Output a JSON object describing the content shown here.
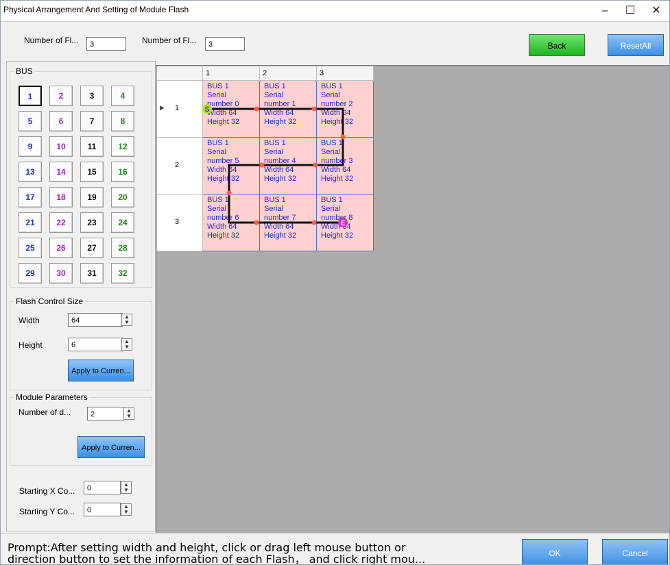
{
  "window": {
    "title": "Physical Arrangement And Setting of Module Flash",
    "minimize_glyph": "–",
    "maximize_glyph": "☐",
    "close_glyph": "✕"
  },
  "topbar": {
    "rows_label": "Number of Fl...",
    "rows_value": "3",
    "cols_label": "Number of Fl...",
    "cols_value": "3",
    "back_label": "Back",
    "reset_label": "ResetAll"
  },
  "bus": {
    "title": "BUS",
    "buttons": [
      "1",
      "2",
      "3",
      "4",
      "5",
      "6",
      "7",
      "8",
      "9",
      "10",
      "11",
      "12",
      "13",
      "14",
      "15",
      "16",
      "17",
      "18",
      "19",
      "20",
      "21",
      "22",
      "23",
      "24",
      "25",
      "26",
      "27",
      "28",
      "29",
      "30",
      "31",
      "32"
    ]
  },
  "flash_size": {
    "title": "Flash Control Size",
    "width_label": "Width",
    "width_value": "64",
    "height_label": "Height",
    "height_value": "6",
    "apply_label": "Apply to Curren..."
  },
  "module_params": {
    "title": "Module Parameters",
    "num_label": "Number of d...",
    "num_value": "2",
    "apply_label": "Apply to Curren..."
  },
  "start": {
    "x_label": "Starting X Co...",
    "x_value": "0",
    "y_label": "Starting Y Co...",
    "y_value": "0"
  },
  "grid": {
    "col_headers": [
      "1",
      "2",
      "3"
    ],
    "row_headers": [
      "1",
      "2",
      "3"
    ],
    "current_row_marker": "▶",
    "start_marker": "S",
    "end_marker": "E",
    "cells": [
      [
        {
          "bus": "BUS 1",
          "l2": "Serial",
          "l3": "number 0",
          "w": "Width 64",
          "h": "Height 32"
        },
        {
          "bus": "BUS 1",
          "l2": "Serial",
          "l3": "number 1",
          "w": "Width 64",
          "h": "Height 32"
        },
        {
          "bus": "BUS 1",
          "l2": "Serial",
          "l3": "number 2",
          "w": "Width 64",
          "h": "Height 32"
        }
      ],
      [
        {
          "bus": "BUS 1",
          "l2": "Serial",
          "l3": "number 5",
          "w": "Width 64",
          "h": "Height 32"
        },
        {
          "bus": "BUS 1",
          "l2": "Serial",
          "l3": "number 4",
          "w": "Width 64",
          "h": "Height 32"
        },
        {
          "bus": "BUS 1",
          "l2": "Serial",
          "l3": "number 3",
          "w": "Width 64",
          "h": "Height 32"
        }
      ],
      [
        {
          "bus": "BUS 1",
          "l2": "Serial",
          "l3": "number 6",
          "w": "Width 64",
          "h": "Height 32"
        },
        {
          "bus": "BUS 1",
          "l2": "Serial",
          "l3": "number 7",
          "w": "Width 64",
          "h": "Height 32"
        },
        {
          "bus": "BUS 1",
          "l2": "Serial",
          "l3": "number 8",
          "w": "Width 64",
          "h": "Height 32"
        }
      ]
    ]
  },
  "footer": {
    "prompt_line1": "Prompt:After setting width and height, click or drag left mouse button or",
    "prompt_line2": "direction button to set the information of each Flash， and click right mou...",
    "ok_label": "OK",
    "cancel_label": "Cancel"
  },
  "colors": {
    "cell_bg": "#ffd0d0",
    "cell_text": "#1d2bd0",
    "grid_bg": "#ababab",
    "green_button": "#1fb51f",
    "blue_button": "#3d8fe3"
  }
}
